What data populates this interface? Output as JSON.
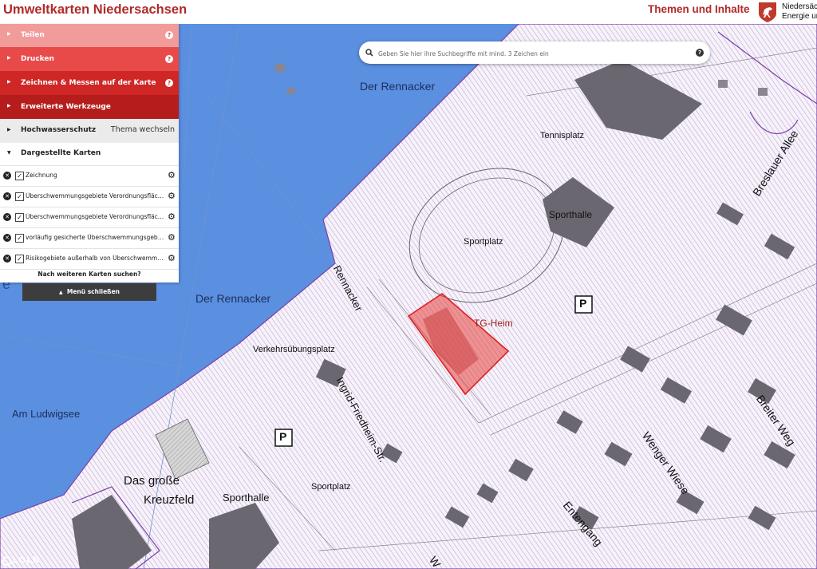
{
  "header": {
    "title": "Umweltkarten Niedersachsen",
    "themes_link": "Themen und Inhalte",
    "logo_lines": [
      "Niedersäch",
      "Energie un"
    ]
  },
  "search": {
    "placeholder": "Geben Sie hier ihre Suchbegriffe mit mind. 3 Zeichen ein"
  },
  "menu": {
    "items": [
      {
        "label": "Teilen"
      },
      {
        "label": "Drucken"
      },
      {
        "label": "Zeichnen & Messen auf der Karte"
      },
      {
        "label": "Erweiterte Werkzeuge"
      }
    ],
    "topic_label": "Hochwasserschutz",
    "topic_switch": "Thema wechseln",
    "maps_header": "Dargestellte Karten",
    "layers": [
      {
        "name": "Zeichnung",
        "checked": true
      },
      {
        "name": "Überschwemmungsgebiete Verordnungsflächen",
        "checked": true
      },
      {
        "name": "Überschwemmungsgebiete Verordnungsflächen",
        "checked": true
      },
      {
        "name": "vorläufig gesicherte Überschwemmungsgebiete",
        "checked": true
      },
      {
        "name": "Risikogebiete außerhalb von Überschwemmungsgebieten",
        "checked": true
      }
    ],
    "more_maps": "Nach weiteren Karten suchen?",
    "close_menu": "Menü schließen"
  },
  "map": {
    "labels": {
      "rennacker_top": "Der Rennacker",
      "rennacker_mid": "Der Rennacker",
      "tennisplatz": "Tennisplatz",
      "sportplatz_top": "Sportplatz",
      "sporthalle_top": "Sporthalle",
      "tg_heim": "TG-Heim",
      "rennacker_street": "Rennacker",
      "verkehrsuebungsplatz": "Verkehrsübungsplatz",
      "ingrid_str": "Ingrid-Friedheim-Str.",
      "am_ludwigsee": "Am Ludwigsee",
      "das_grosse": "Das große",
      "kreuzfeld": "Kreuzfeld",
      "sporthalle_bottom": "Sporthalle",
      "sportplatz_bottom": "Sportplatz",
      "breslauer_allee": "Breslauer Allee",
      "breiter_weg": "Breiter Weg",
      "wenger_wiese": "Wenger Wiese",
      "entengang": "Entengang",
      "parking": "P",
      "partial_e": "e",
      "partial_w": "W",
      "attribution": "LGLN"
    }
  },
  "colors": {
    "brand": "#b02a2a",
    "water": "#5b8fe0",
    "flood_hatch": "#b7a2cf",
    "selection": "#e7413c"
  }
}
